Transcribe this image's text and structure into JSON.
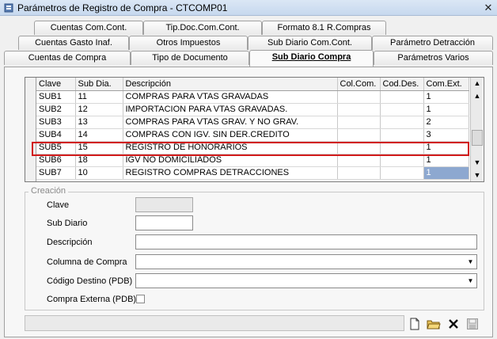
{
  "window": {
    "title": "Parámetros de Registro de Compra - CTCOMP01",
    "close_glyph": "✕"
  },
  "tabs": {
    "row1": [
      {
        "label": "Cuentas Com.Cont."
      },
      {
        "label": "Tip.Doc.Com.Cont."
      },
      {
        "label": "Formato 8.1 R.Compras"
      }
    ],
    "row2": [
      {
        "label": "Cuentas Gasto Inaf."
      },
      {
        "label": "Otros Impuestos"
      },
      {
        "label": "Sub Diario Com.Cont."
      },
      {
        "label": "Parámetro Detracción"
      }
    ],
    "row3": [
      {
        "label": "Cuentas de Compra"
      },
      {
        "label": "Tipo de Documento"
      },
      {
        "label": "Sub Diario Compra"
      },
      {
        "label": "Parámetros Varios"
      }
    ],
    "active_tab": "Sub Diario Compra"
  },
  "grid": {
    "columns": [
      "Clave",
      "Sub Dia.",
      "Descripción",
      "Col.Com.",
      "Cod.Des.",
      "Com.Ext."
    ],
    "rows": [
      {
        "clave": "SUB1",
        "subdia": "11",
        "descripcion": "COMPRAS PARA VTAS GRAVADAS",
        "colcom": "",
        "coddes": "",
        "comext": "1"
      },
      {
        "clave": "SUB2",
        "subdia": "12",
        "descripcion": "IMPORTACION PARA VTAS GRAVADAS.",
        "colcom": "",
        "coddes": "",
        "comext": "1"
      },
      {
        "clave": "SUB3",
        "subdia": "13",
        "descripcion": "COMPRAS PARA VTAS GRAV. Y NO GRAV.",
        "colcom": "",
        "coddes": "",
        "comext": "2"
      },
      {
        "clave": "SUB4",
        "subdia": "14",
        "descripcion": "COMPRAS CON IGV. SIN DER.CREDITO",
        "colcom": "",
        "coddes": "",
        "comext": "3"
      },
      {
        "clave": "SUB5",
        "subdia": "15",
        "descripcion": "REGISTRO DE HONORARIOS",
        "colcom": "",
        "coddes": "",
        "comext": "1"
      },
      {
        "clave": "SUB6",
        "subdia": "18",
        "descripcion": "IGV NO DOMICILIADOS",
        "colcom": "",
        "coddes": "",
        "comext": "1"
      },
      {
        "clave": "SUB7",
        "subdia": "10",
        "descripcion": "REGISTRO COMPRAS DETRACCIONES",
        "colcom": "",
        "coddes": "",
        "comext": "1"
      }
    ],
    "highlighted_row": "SUB5"
  },
  "form": {
    "legend": "Creación",
    "clave_label": "Clave",
    "clave_value": "",
    "subdiario_label": "Sub Diario",
    "subdiario_value": "",
    "descripcion_label": "Descripción",
    "descripcion_value": "",
    "columna_label": "Columna de Compra",
    "columna_value": "",
    "codigo_label": "Código Destino (PDB)",
    "codigo_value": "",
    "compra_externa_label": "Compra Externa (PDB)",
    "compra_externa_checked": false
  },
  "toolbar": {
    "new_icon": "new-document-icon",
    "open_icon": "open-folder-icon",
    "delete_icon": "delete-x-icon",
    "save_icon": "save-disk-icon"
  }
}
